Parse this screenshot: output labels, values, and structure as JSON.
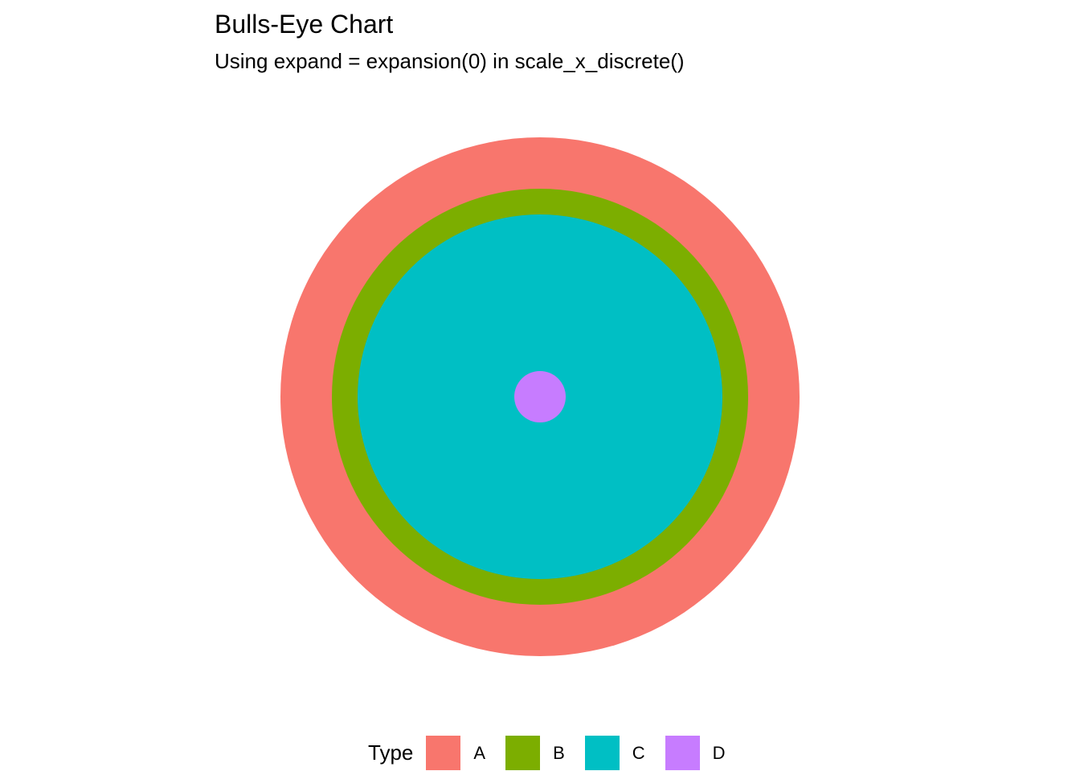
{
  "chart_data": {
    "type": "pie",
    "title": "Bulls-Eye Chart",
    "subtitle": "Using expand = expansion(0) in scale_x_discrete()",
    "xlabel": "",
    "ylabel": "",
    "grid": false,
    "legend_position": "bottom",
    "legend_title": "Type",
    "categories": [
      "A",
      "B",
      "C",
      "D"
    ],
    "values": [
      1,
      1,
      1,
      1
    ],
    "series": [
      {
        "name": "A",
        "color": "#F8766D"
      },
      {
        "name": "B",
        "color": "#7CAE00"
      },
      {
        "name": "C",
        "color": "#00BFC4"
      },
      {
        "name": "D",
        "color": "#C77CFF"
      }
    ]
  }
}
